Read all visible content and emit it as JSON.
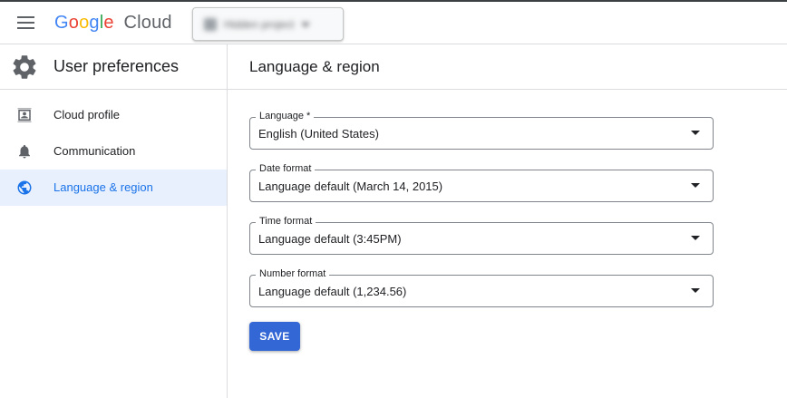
{
  "app": {
    "logo": {
      "google": [
        "G",
        "o",
        "o",
        "g",
        "l",
        "e"
      ],
      "google_colors": [
        "#4285f4",
        "#ea4335",
        "#fbbc05",
        "#4285f4",
        "#34a853",
        "#ea4335"
      ],
      "product": "Cloud"
    },
    "project_picker": {
      "label": "Hidden project"
    }
  },
  "sidebar": {
    "title": "User preferences",
    "title_icon": "gear-icon",
    "items": [
      {
        "label": "Cloud profile",
        "icon": "profile-card-icon",
        "active": false
      },
      {
        "label": "Communication",
        "icon": "bell-icon",
        "active": false
      },
      {
        "label": "Language & region",
        "icon": "globe-icon",
        "active": true
      }
    ]
  },
  "main": {
    "title": "Language & region",
    "fields": [
      {
        "label": "Language *",
        "value": "English (United States)"
      },
      {
        "label": "Date format",
        "value": "Language default (March 14, 2015)"
      },
      {
        "label": "Time format",
        "value": "Language default (3:45PM)"
      },
      {
        "label": "Number format",
        "value": "Language default (1,234.56)"
      }
    ],
    "save_label": "SAVE"
  },
  "colors": {
    "accent": "#1a73e8",
    "save_button": "#3367d6",
    "active_bg": "#e8f0fe",
    "icon_gray": "#5f6368"
  }
}
